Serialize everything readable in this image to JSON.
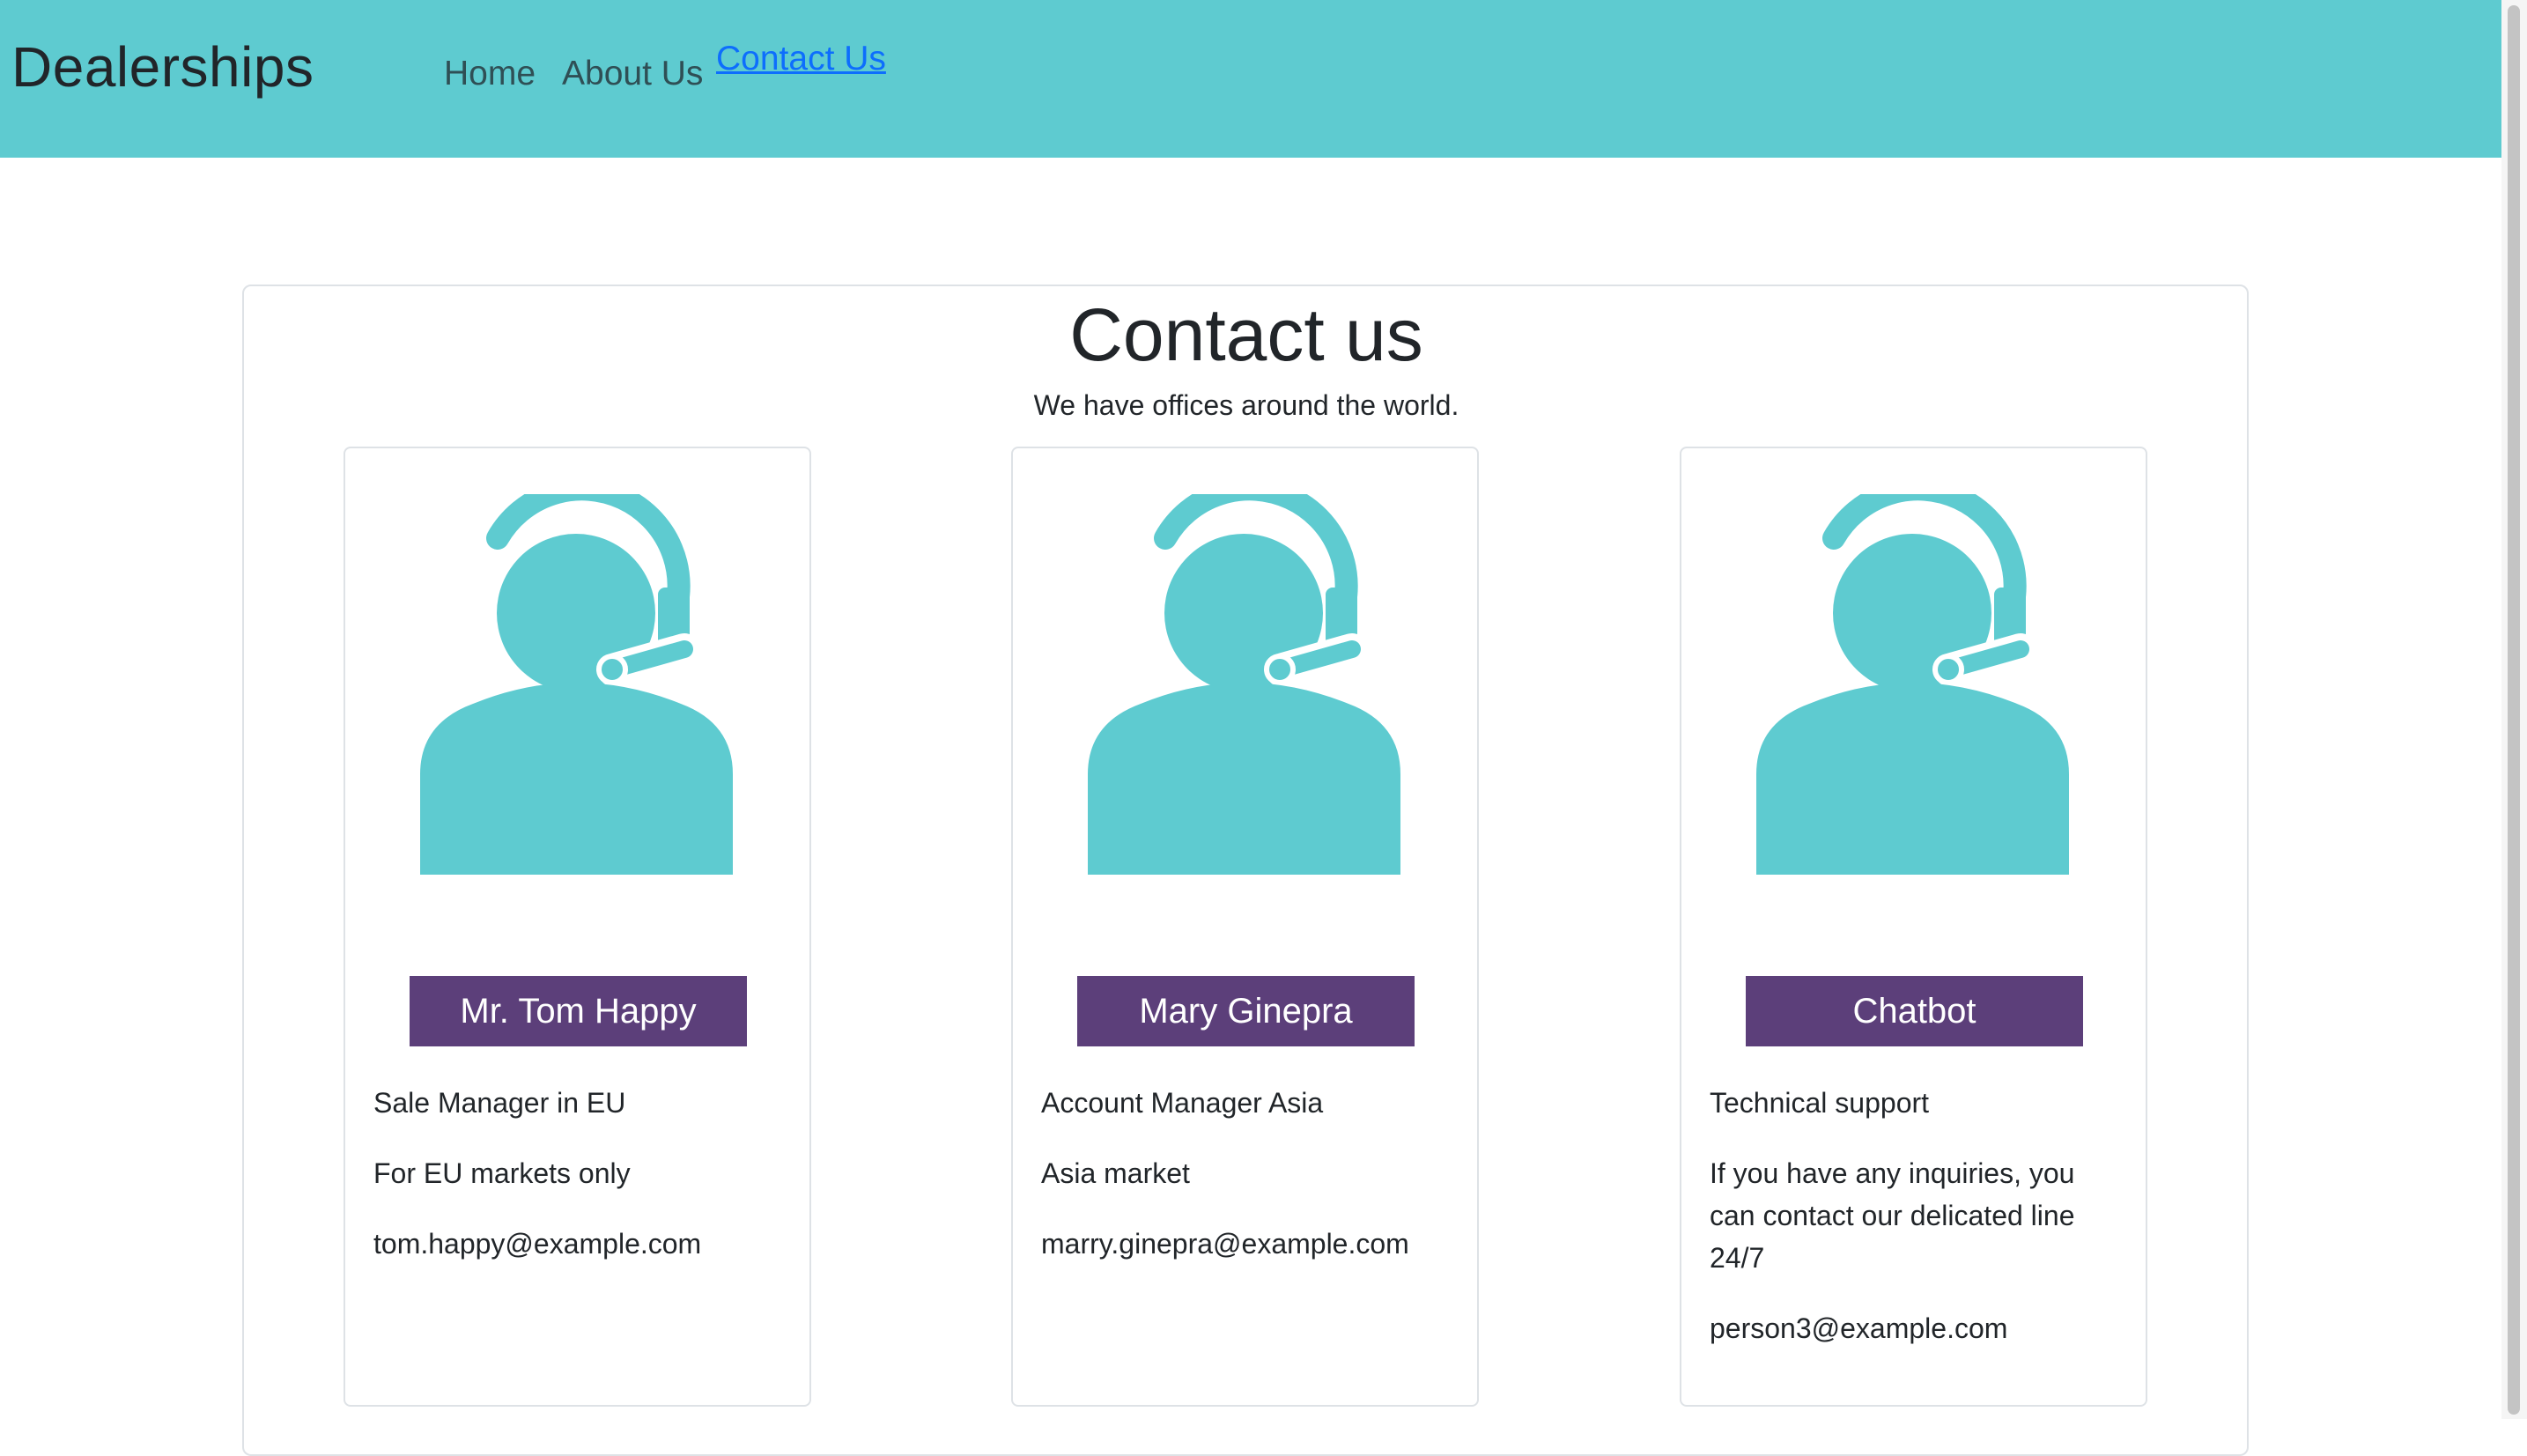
{
  "navbar": {
    "brand": "Dealerships",
    "links": [
      "Home",
      "About Us",
      "Contact Us"
    ],
    "background": "#5ecbd0"
  },
  "main": {
    "title": "Contact us",
    "subtitle": "We have offices around the world."
  },
  "contacts": [
    {
      "name": "Mr. Tom Happy",
      "role": "Sale Manager in EU",
      "description": "For EU markets only",
      "email": "tom.happy@example.com"
    },
    {
      "name": "Mary Ginepra",
      "role": "Account Manager Asia",
      "description": "Asia market",
      "email": "marry.ginepra@example.com"
    },
    {
      "name": "Chatbot",
      "role": "Technical support",
      "description": "If you have any inquiries, you can contact our delicated line 24/7",
      "email": "person3@example.com"
    }
  ],
  "colors": {
    "accent": "#5ecbd0",
    "badge": "#5c3f7a",
    "active_link": "#0d6efd"
  },
  "icons": {
    "contact_avatar": "headset-person-icon"
  }
}
